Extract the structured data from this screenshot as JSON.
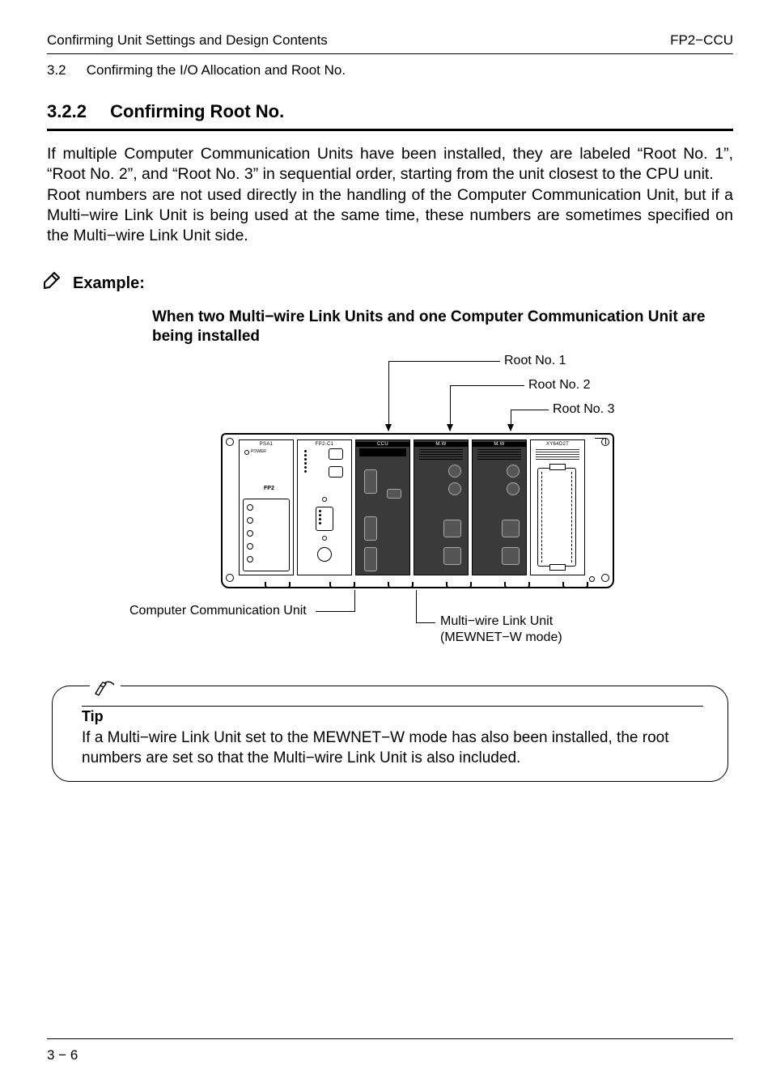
{
  "header": {
    "left": "Confirming Unit Settings and Design Contents",
    "right": "FP2−CCU"
  },
  "section_line": {
    "num": "3.2",
    "title": "Confirming the I/O Allocation and Root No."
  },
  "heading": {
    "num": "3.2.2",
    "title": "Confirming Root No."
  },
  "body": "If multiple Computer Communication Units have been installed, they are labeled “Root No. 1”, “Root No. 2”, and “Root No. 3” in sequential order, starting from the unit closest to the CPU unit.\nRoot numbers are not used directly in the handling of the Computer Communication Unit, but if a Multi−wire Link Unit is being used at the same time, these numbers are sometimes specified on the Multi−wire Link Unit side.",
  "example_label": "Example:",
  "diagram": {
    "subtitle": "When two Multi−wire Link Units and one Computer Communication Unit are being installed",
    "root1": "Root No. 1",
    "root2": "Root No. 2",
    "root3": "Root No. 3",
    "callout_left": "Computer Communication Unit",
    "callout_right1": "Multi−wire Link Unit",
    "callout_right2": "(MEWNET−W mode)",
    "slot_labels": {
      "psu": "PSA1",
      "cpu": "FP2-C1",
      "ccu": "CCU",
      "mw": "M.W",
      "io": "XY64D2T",
      "fp2": "FP2",
      "power": "POWER"
    }
  },
  "tip": {
    "title": "Tip",
    "text": "If a Multi−wire Link Unit set to the MEWNET−W mode has also been installed, the root numbers are set so that the Multi−wire Link Unit is also included."
  },
  "footer": "3 − 6"
}
